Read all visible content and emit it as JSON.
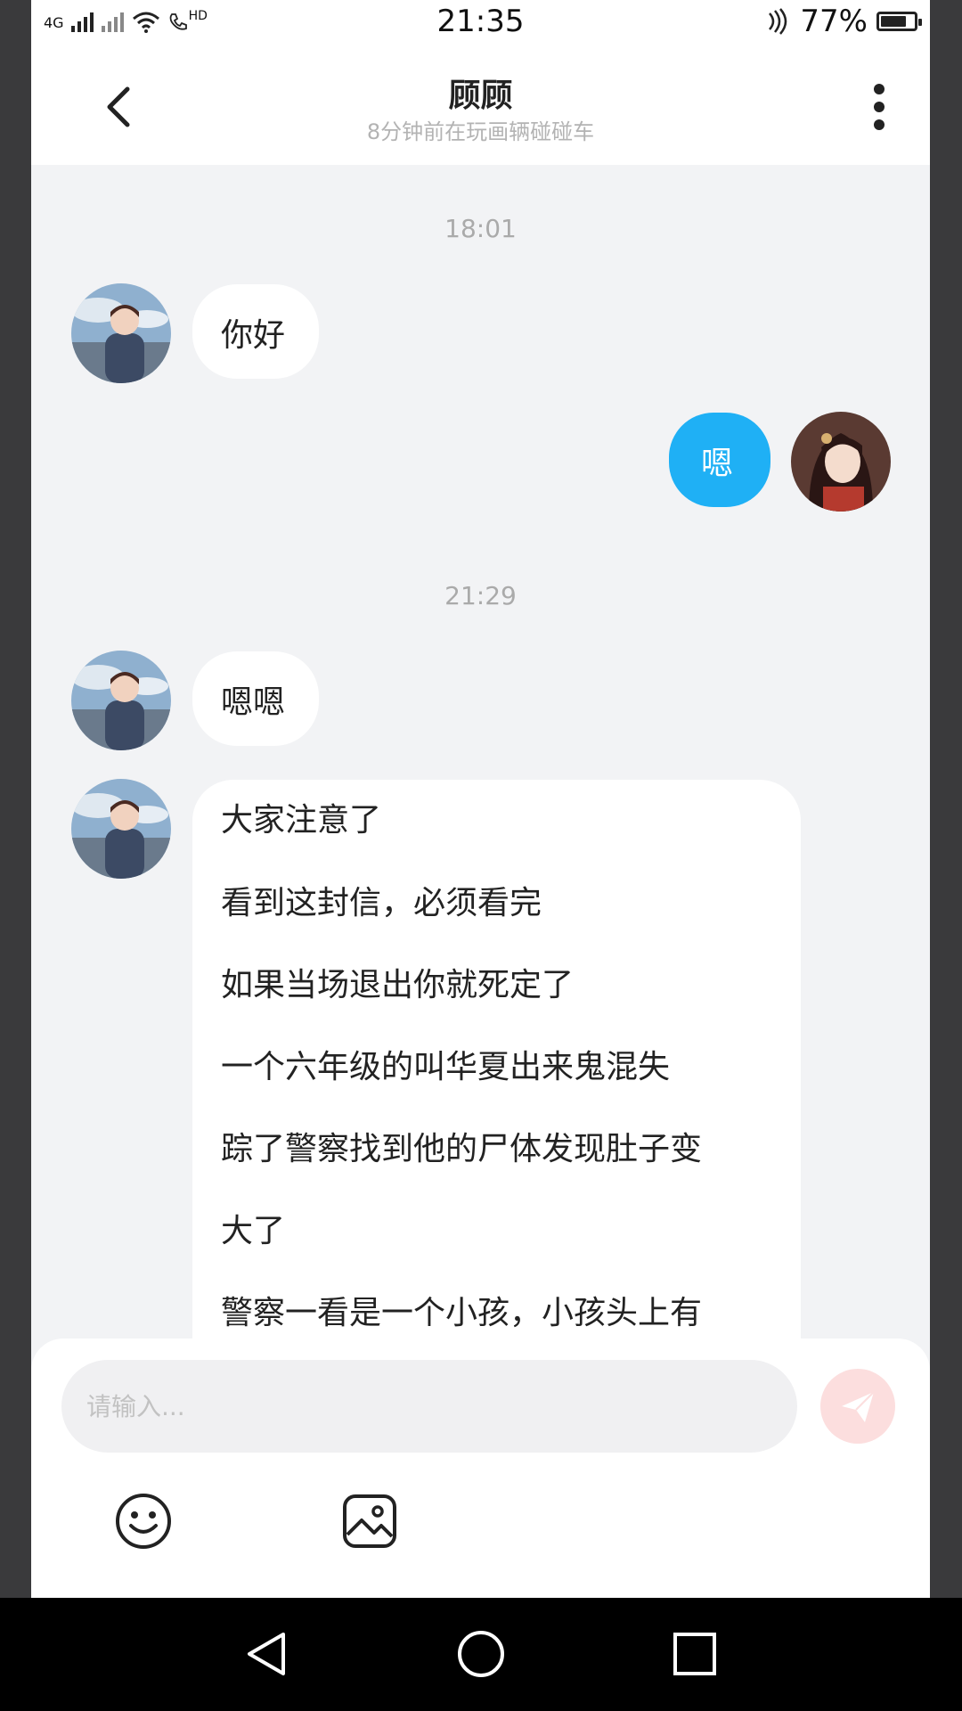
{
  "status_bar": {
    "network_1": "4G",
    "hd_label": "HD",
    "time": "21:35",
    "battery_percent": "77%",
    "battery_level": 0.77
  },
  "header": {
    "title": "顾顾",
    "subtitle": "8分钟前在玩画辆碰碰车"
  },
  "chat": {
    "timestamps": [
      "18:01",
      "21:29"
    ],
    "messages": [
      {
        "side": "in",
        "text": "你好"
      },
      {
        "side": "out",
        "text": "嗯"
      },
      {
        "side": "in",
        "text": "嗯嗯"
      },
      {
        "side": "in",
        "lines": [
          "大家注意了",
          "看到这封信，必须看完",
          "如果当场退出你就死定了",
          "一个六年级的叫华夏出来鬼混失",
          "踪了警察找到他的尸体发现肚子变",
          "大了",
          "警察一看是一个小孩，小孩头上有"
        ]
      }
    ]
  },
  "input": {
    "placeholder": "请输入..."
  },
  "icons": {
    "back": "chevron-left-icon",
    "more": "more-vertical-icon",
    "send": "send-icon",
    "emoji": "emoji-icon",
    "image": "image-icon"
  },
  "colors": {
    "out_bubble": "#1fb0f5",
    "send_button": "#fcdede",
    "chat_bg": "#f2f3f5"
  }
}
